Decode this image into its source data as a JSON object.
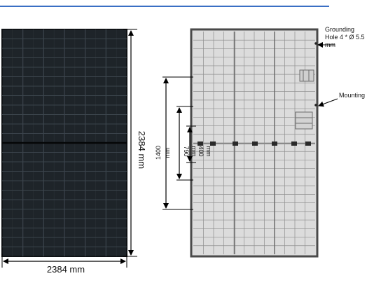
{
  "front_panel": {
    "height_label": "2384 mm",
    "width_label": "2384 mm"
  },
  "rear_panel": {
    "grounding_label": [
      "Grounding",
      "Hole 4 * Ø 5.5",
      "mm"
    ],
    "mounting_label": "Mounting",
    "dimensions": [
      {
        "value": "1400",
        "unit": "mm"
      },
      {
        "value": "790",
        "unit": "mm"
      },
      {
        "value": "400",
        "unit": "mm"
      }
    ]
  },
  "colors": {
    "header_rule": "#3a6fc4",
    "front_panel_fill": "#1e2429",
    "rear_panel_fill": "#dcdcdc",
    "frame": "#4a4a4a"
  }
}
